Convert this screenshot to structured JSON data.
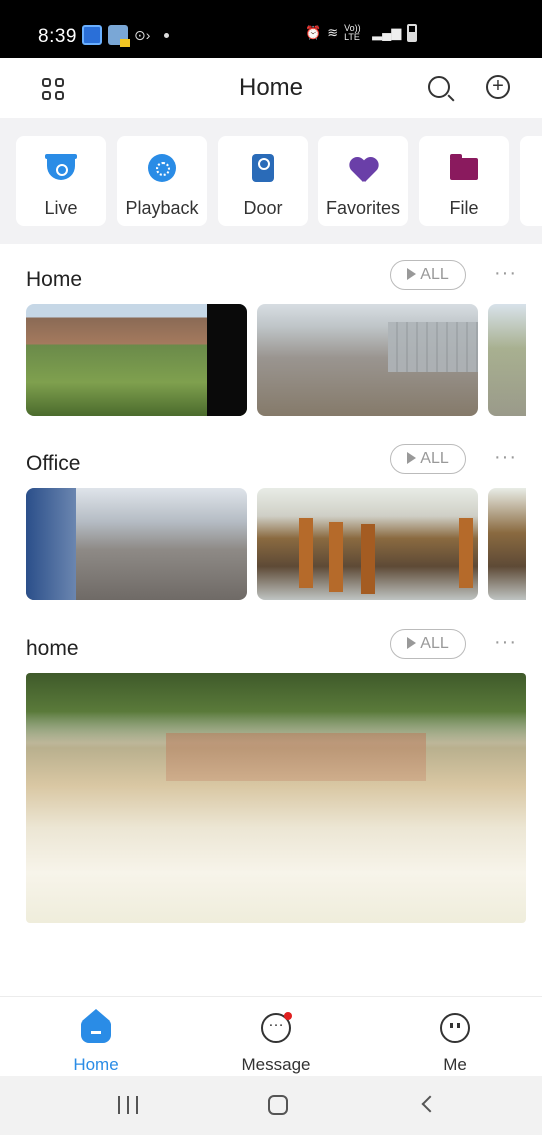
{
  "status_bar": {
    "time": "8:39",
    "network": "Vo)) LTE"
  },
  "header": {
    "title": "Home",
    "icons": [
      "grid-icon",
      "search-icon",
      "add-icon"
    ]
  },
  "quick_tiles": [
    {
      "label": "Live",
      "icon": "camera-dome-icon",
      "color": "#2a8ce6"
    },
    {
      "label": "Playback",
      "icon": "playback-reel-icon",
      "color": "#2a8ce6"
    },
    {
      "label": "Door",
      "icon": "door-station-icon",
      "color": "#2a6bb8"
    },
    {
      "label": "Favorites",
      "icon": "heart-icon",
      "color": "#6a3fa8"
    },
    {
      "label": "File",
      "icon": "folder-icon",
      "color": "#8a1a5e"
    }
  ],
  "groups": [
    {
      "title": "Home",
      "all_label": "ALL",
      "more": "···"
    },
    {
      "title": "Office",
      "all_label": "ALL",
      "more": "···"
    },
    {
      "title": "home",
      "all_label": "ALL",
      "more": "···"
    }
  ],
  "bottom_nav": [
    {
      "label": "Home",
      "icon": "home-icon",
      "active": true
    },
    {
      "label": "Message",
      "icon": "message-icon",
      "badge": true
    },
    {
      "label": "Me",
      "icon": "me-icon"
    }
  ],
  "colors": {
    "accent": "#2a8ce6",
    "badge": "#e02020"
  }
}
